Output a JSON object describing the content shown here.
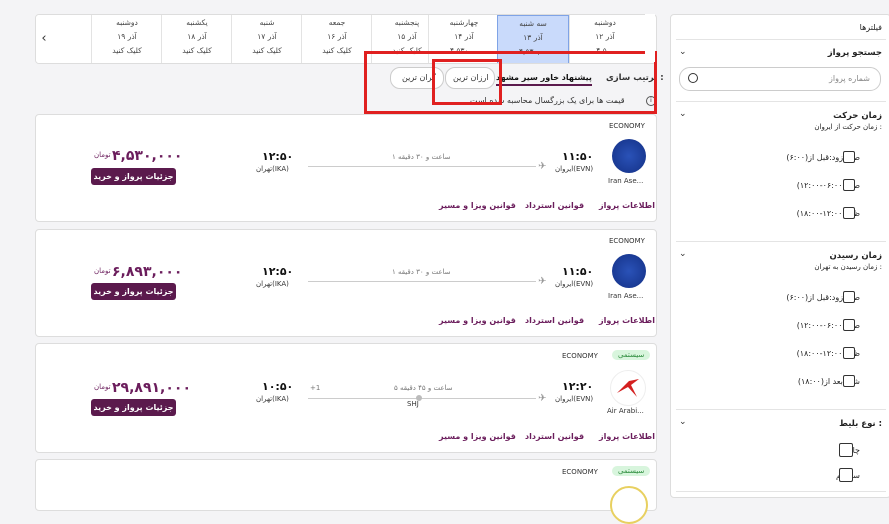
{
  "dates": [
    {
      "day": "دوشنبه",
      "date": "۱۹ آذر",
      "price": "کلیک کنید"
    },
    {
      "day": "یکشنبه",
      "date": "۱۸ آذر",
      "price": "کلیک کنید"
    },
    {
      "day": "شنبه",
      "date": "۱۷ آذر",
      "price": "کلیک کنید"
    },
    {
      "day": "جمعه",
      "date": "۱۶ آذر",
      "price": "کلیک کنید"
    },
    {
      "day": "پنجشنبه",
      "date": "۱۵ آذر",
      "price": "کلیک کنید"
    },
    {
      "day": "چهارشنبه",
      "date": "۱۴ آذر",
      "price": "۴,۵۳۰,..."
    },
    {
      "day": "سه شنبه",
      "date": "۱۳ آذر",
      "price": "۴,۵۳۰,..."
    },
    {
      "day": "دوشنبه",
      "date": "۱۲ آذر",
      "price": "۴,۵..."
    }
  ],
  "sort": {
    "label": "ترتیب سازی :",
    "options": [
      "پیشنهاد خاور سیر مشهد",
      "ارزان ترین",
      "گران ترین"
    ],
    "note": "قیمت ها برای یک بزرگسال محاسبه شده است"
  },
  "filters": {
    "title": "فیلترها",
    "search_title": "جستجو پرواز",
    "search_placeholder": "شماره پرواز",
    "departure_title": "زمان حرکت",
    "departure_sub": "زمان حرکت از ایروان :",
    "departure_opts": [
      "صبح زود:قبل از(۶:۰۰)",
      "صبح(۰۶:۰۰-۱۲:۰۰)",
      "ظهر(۱۲:۰۰-۱۸:۰۰)"
    ],
    "arrival_title": "زمان رسیدن",
    "arrival_sub": "زمان رسیدن به تهران :",
    "arrival_opts": [
      "صبح زود:قبل از(۶:۰۰)",
      "صبح(۰۶:۰۰-۱۲:۰۰)",
      "ظهر(۱۲:۰۰-۱۸:۰۰)",
      "شب بعد از(۱۸:۰۰)"
    ],
    "ticket_title": "نوع بلیط :",
    "ticket_opts": [
      "چارتر",
      "سیستم"
    ]
  },
  "flights": [
    {
      "class": "ECONOMY",
      "badge": "",
      "airline": "Iran Ase...",
      "dep_time": "۱۱:۵۰",
      "dep_city": "ایروان(EVN)",
      "duration": "۱ ساعت و ۳۰ دقیقه",
      "stop": "",
      "arr_time": "۱۲:۵۰",
      "arr_city": "تهران(IKA)",
      "price": "۴,۵۳۰,۰۰۰",
      "currency": "تومان",
      "buy": "جزئیات پرواز و خرید",
      "links": [
        "اطلاعات پرواز",
        "قوانین استرداد",
        "قوانین ویزا و مسیر"
      ],
      "plus": ""
    },
    {
      "class": "ECONOMY",
      "badge": "",
      "airline": "Iran Ase...",
      "dep_time": "۱۱:۵۰",
      "dep_city": "ایروان(EVN)",
      "duration": "۱ ساعت و ۳۰ دقیقه",
      "stop": "",
      "arr_time": "۱۲:۵۰",
      "arr_city": "تهران(IKA)",
      "price": "۶,۸۹۳,۰۰۰",
      "currency": "تومان",
      "buy": "جزئیات پرواز و خرید",
      "links": [
        "اطلاعات پرواز",
        "قوانین استرداد",
        "قوانین ویزا و مسیر"
      ],
      "plus": ""
    },
    {
      "class": "ECONOMY",
      "badge": "سیستمی",
      "airline": "Air Arabi...",
      "dep_time": "۱۲:۲۰",
      "dep_city": "ایروان(EVN)",
      "duration": "۵ ساعت و ۴۵ دقیقه",
      "stop": "SHJ",
      "arr_time": "۱۰:۵۰",
      "arr_city": "تهران(IKA)",
      "price": "۲۹,۸۹۱,۰۰۰",
      "currency": "تومان",
      "buy": "جزئیات پرواز و خرید",
      "links": [
        "اطلاعات پرواز",
        "قوانین استرداد",
        "قوانین ویزا و مسیر"
      ],
      "plus": "+1"
    },
    {
      "class": "ECONOMY",
      "badge": "سیستمی"
    }
  ]
}
